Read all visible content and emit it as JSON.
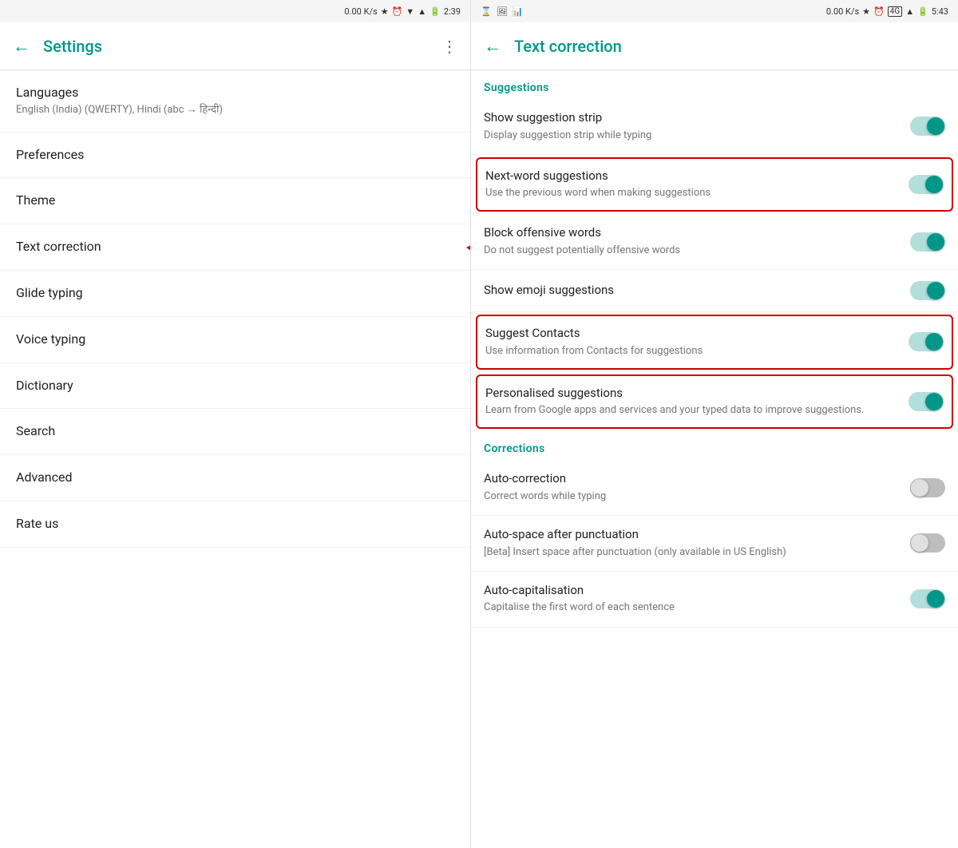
{
  "left": {
    "status_bar": {
      "speed": "0.00 K/s",
      "time": "2:39"
    },
    "header": {
      "title": "Settings",
      "back_label": "←",
      "menu_label": "⋮"
    },
    "nav_items": [
      {
        "title": "Languages",
        "subtitle": "English (India) (QWERTY), Hindi (abc → हिन्दी)",
        "selected": false
      },
      {
        "title": "Preferences",
        "subtitle": "",
        "selected": false
      },
      {
        "title": "Theme",
        "subtitle": "",
        "selected": false
      },
      {
        "title": "Text correction",
        "subtitle": "",
        "selected": true
      },
      {
        "title": "Glide typing",
        "subtitle": "",
        "selected": false
      },
      {
        "title": "Voice typing",
        "subtitle": "",
        "selected": false
      },
      {
        "title": "Dictionary",
        "subtitle": "",
        "selected": false
      },
      {
        "title": "Search",
        "subtitle": "",
        "selected": false
      },
      {
        "title": "Advanced",
        "subtitle": "",
        "selected": false
      },
      {
        "title": "Rate us",
        "subtitle": "",
        "selected": false
      }
    ]
  },
  "right": {
    "status_bar": {
      "speed": "0.00 K/s",
      "time": "5:43",
      "left_icons": "⌛ 🖼 📈"
    },
    "header": {
      "title": "Text correction",
      "back_label": "←"
    },
    "sections": [
      {
        "label": "Suggestions",
        "items": [
          {
            "title": "Show suggestion strip",
            "subtitle": "Display suggestion strip while typing",
            "toggle": "on",
            "highlighted": false
          },
          {
            "title": "Next-word suggestions",
            "subtitle": "Use the previous word when making suggestions",
            "toggle": "on",
            "highlighted": true
          },
          {
            "title": "Block offensive words",
            "subtitle": "Do not suggest potentially offensive words",
            "toggle": "on",
            "highlighted": false
          },
          {
            "title": "Show emoji suggestions",
            "subtitle": "",
            "toggle": "on",
            "highlighted": false
          },
          {
            "title": "Suggest Contacts",
            "subtitle": "Use information from Contacts for suggestions",
            "toggle": "on",
            "highlighted": true
          },
          {
            "title": "Personalised suggestions",
            "subtitle": "Learn from Google apps and services and your typed data to improve suggestions.",
            "toggle": "on",
            "highlighted": true
          }
        ]
      },
      {
        "label": "Corrections",
        "items": [
          {
            "title": "Auto-correction",
            "subtitle": "Correct words while typing",
            "toggle": "off",
            "highlighted": false
          },
          {
            "title": "Auto-space after punctuation",
            "subtitle": "[Beta] Insert space after punctuation (only available in US English)",
            "toggle": "off",
            "highlighted": false
          },
          {
            "title": "Auto-capitalisation",
            "subtitle": "Capitalise the first word of each sentence",
            "toggle": "on",
            "highlighted": false
          }
        ]
      }
    ]
  }
}
